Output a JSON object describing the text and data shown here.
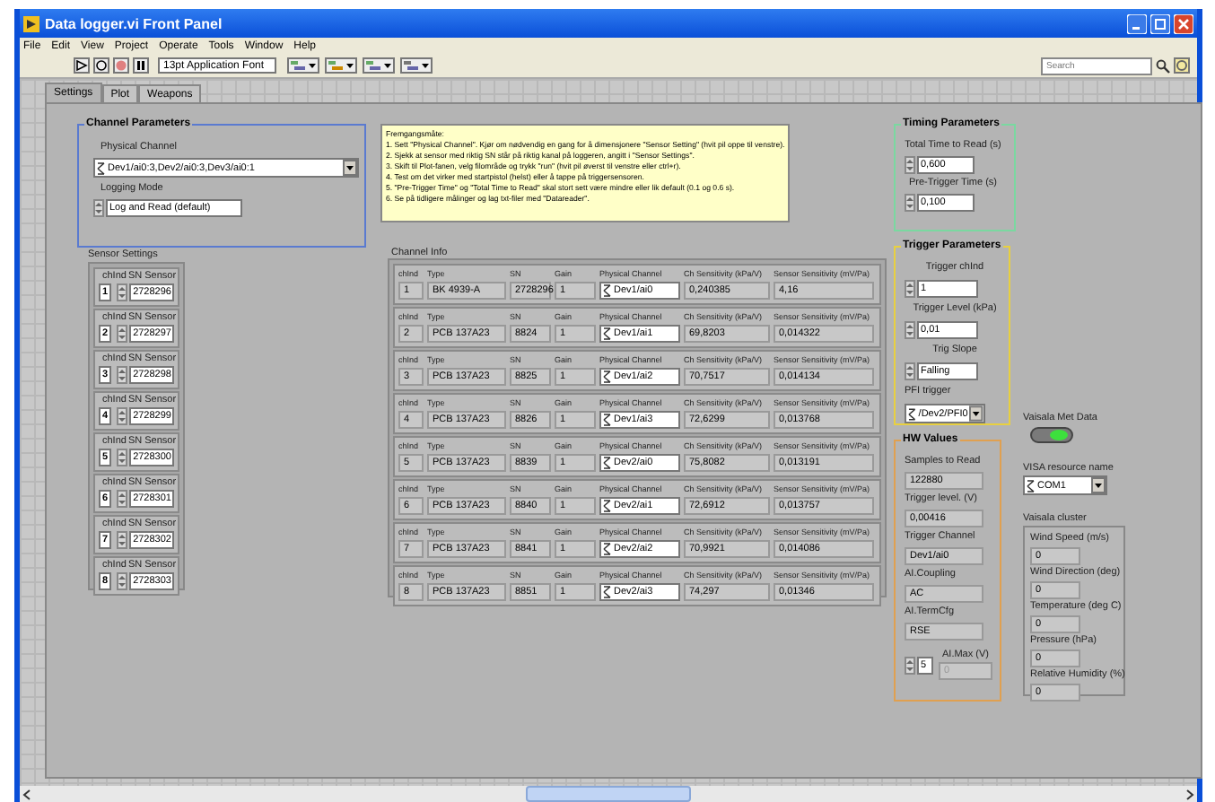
{
  "window": {
    "title": "Data logger.vi Front Panel"
  },
  "menu": [
    "File",
    "Edit",
    "View",
    "Project",
    "Operate",
    "Tools",
    "Window",
    "Help"
  ],
  "toolbar": {
    "font": "13pt Application Font",
    "search": {
      "placeholder": "Search"
    }
  },
  "tabs": [
    {
      "label": "Settings",
      "selected": true
    },
    {
      "label": "Plot",
      "selected": false
    },
    {
      "label": "Weapons",
      "selected": false
    }
  ],
  "channel_parameters": {
    "title": "Channel Parameters",
    "physical_channel": {
      "label": "Physical Channel",
      "value": "Dev1/ai0:3,Dev2/ai0:3,Dev3/ai0:1"
    },
    "logging_mode": {
      "label": "Logging Mode",
      "value": "Log and Read (default)"
    }
  },
  "instructions": {
    "lines": [
      "Fremgangsmåte:",
      "1. Sett \"Physical Channel\". Kjør om nødvendig en gang for å dimensjonere \"Sensor Setting\" (hvit pil oppe til venstre).",
      "2. Sjekk at sensor med riktig SN står på riktig kanal på loggeren, angitt i \"Sensor Settings\".",
      "3. Skift til Plot-fanen, velg filområde og trykk \"run\" (hvit pil øverst til venstre eller ctrl+r).",
      "4. Test om det virker med startpistol (helst) eller å tappe på triggersensoren.",
      "5. \"Pre-Trigger Time\" og \"Total Time to Read\" skal stort sett være mindre eller lik default (0.1 og 0.6 s).",
      "6. Se på tidligere målinger og lag txt-filer med \"Datareader\"."
    ]
  },
  "timing_parameters": {
    "title": "Timing Parameters",
    "fields": [
      {
        "kind": "numeric",
        "label": "Total Time to Read (s)",
        "value": "0,600"
      },
      {
        "kind": "numeric",
        "label": "Pre-Trigger Time (s)",
        "value": "0,100"
      }
    ]
  },
  "sensor_settings": {
    "label": "Sensor Settings",
    "items": [
      {
        "chind_label": "chInd",
        "sn_label": "SN Sensor",
        "chind": "1",
        "sn": "2728296"
      },
      {
        "chind_label": "chInd",
        "sn_label": "SN Sensor",
        "chind": "2",
        "sn": "2728297"
      },
      {
        "chind_label": "chInd",
        "sn_label": "SN Sensor",
        "chind": "3",
        "sn": "2728298"
      },
      {
        "chind_label": "chInd",
        "sn_label": "SN Sensor",
        "chind": "4",
        "sn": "2728299"
      },
      {
        "chind_label": "chInd",
        "sn_label": "SN Sensor",
        "chind": "5",
        "sn": "2728300"
      },
      {
        "chind_label": "chInd",
        "sn_label": "SN Sensor",
        "chind": "6",
        "sn": "2728301"
      },
      {
        "chind_label": "chInd",
        "sn_label": "SN Sensor",
        "chind": "7",
        "sn": "2728302"
      },
      {
        "chind_label": "chInd",
        "sn_label": "SN Sensor",
        "chind": "8",
        "sn": "2728303"
      }
    ]
  },
  "channel_info": {
    "label": "Channel Info",
    "rows": [
      {
        "headers": [
          "chInd",
          "Type",
          "SN",
          "Gain",
          "Physical Channel",
          "Ch Sensitivity (kPa/V)",
          "Sensor Sensitivity (mV/Pa)"
        ],
        "cells": [
          "1",
          "BK 4939-A",
          "2728296",
          "1",
          "Dev1/ai0",
          "0,240385",
          "4,16"
        ]
      },
      {
        "headers": [
          "chInd",
          "Type",
          "SN",
          "Gain",
          "Physical Channel",
          "Ch Sensitivity (kPa/V)",
          "Sensor Sensitivity (mV/Pa)"
        ],
        "cells": [
          "2",
          "PCB 137A23",
          "8824",
          "1",
          "Dev1/ai1",
          "69,8203",
          "0,014322"
        ]
      },
      {
        "headers": [
          "chInd",
          "Type",
          "SN",
          "Gain",
          "Physical Channel",
          "Ch Sensitivity (kPa/V)",
          "Sensor Sensitivity (mV/Pa)"
        ],
        "cells": [
          "3",
          "PCB 137A23",
          "8825",
          "1",
          "Dev1/ai2",
          "70,7517",
          "0,014134"
        ]
      },
      {
        "headers": [
          "chInd",
          "Type",
          "SN",
          "Gain",
          "Physical Channel",
          "Ch Sensitivity (kPa/V)",
          "Sensor Sensitivity (mV/Pa)"
        ],
        "cells": [
          "4",
          "PCB 137A23",
          "8826",
          "1",
          "Dev1/ai3",
          "72,6299",
          "0,013768"
        ]
      },
      {
        "headers": [
          "chInd",
          "Type",
          "SN",
          "Gain",
          "Physical Channel",
          "Ch Sensitivity (kPa/V)",
          "Sensor Sensitivity (mV/Pa)"
        ],
        "cells": [
          "5",
          "PCB 137A23",
          "8839",
          "1",
          "Dev2/ai0",
          "75,8082",
          "0,013191"
        ]
      },
      {
        "headers": [
          "chInd",
          "Type",
          "SN",
          "Gain",
          "Physical Channel",
          "Ch Sensitivity (kPa/V)",
          "Sensor Sensitivity (mV/Pa)"
        ],
        "cells": [
          "6",
          "PCB 137A23",
          "8840",
          "1",
          "Dev2/ai1",
          "72,6912",
          "0,013757"
        ]
      },
      {
        "headers": [
          "chInd",
          "Type",
          "SN",
          "Gain",
          "Physical Channel",
          "Ch Sensitivity (kPa/V)",
          "Sensor Sensitivity (mV/Pa)"
        ],
        "cells": [
          "7",
          "PCB 137A23",
          "8841",
          "1",
          "Dev2/ai2",
          "70,9921",
          "0,014086"
        ]
      },
      {
        "headers": [
          "chInd",
          "Type",
          "SN",
          "Gain",
          "Physical Channel",
          "Ch Sensitivity (kPa/V)",
          "Sensor Sensitivity (mV/Pa)"
        ],
        "cells": [
          "8",
          "PCB 137A23",
          "8851",
          "1",
          "Dev2/ai3",
          "74,297",
          "0,01346"
        ]
      }
    ]
  },
  "trigger_parameters": {
    "title": "Trigger Parameters",
    "fields": [
      {
        "kind": "numeric",
        "label": "Trigger chInd",
        "value": "1"
      },
      {
        "kind": "numeric",
        "label": "Trigger Level (kPa)",
        "value": "0,01"
      },
      {
        "kind": "numeric",
        "label": "Trig Slope",
        "value": "Falling"
      },
      {
        "kind": "ring",
        "label": "PFI trigger",
        "value": "/Dev2/PFI0"
      }
    ]
  },
  "vaisala_met_data": {
    "label": "Vaisala Met Data",
    "on": true
  },
  "hw_values": {
    "title": "HW Values",
    "fields": [
      {
        "label": "Samples to Read",
        "value": "122880"
      },
      {
        "label": "Trigger level. (V)",
        "value": "0,00416"
      },
      {
        "label": "Trigger Channel",
        "value": "Dev1/ai0"
      },
      {
        "label": "AI.Coupling",
        "value": "AC"
      },
      {
        "label": "AI.TermCfg",
        "value": "RSE"
      }
    ],
    "ai_max": {
      "control": "5",
      "label": "AI.Max (V)",
      "value": "0",
      "disabled": true
    }
  },
  "visa": {
    "label": "VISA resource name",
    "value": "COM1"
  },
  "vaisala_cluster": {
    "label": "Vaisala cluster",
    "fields": [
      {
        "label": "Wind Speed (m/s)",
        "value": "0"
      },
      {
        "label": "Wind Direction (deg)",
        "value": "0"
      },
      {
        "label": "Temperature (deg C)",
        "value": "0"
      },
      {
        "label": "Pressure (hPa)",
        "value": "0"
      },
      {
        "label": "Relative Humidity (%)",
        "value": "0"
      }
    ]
  }
}
